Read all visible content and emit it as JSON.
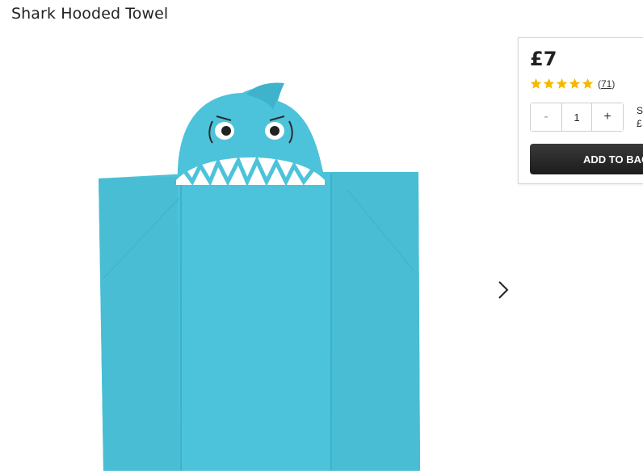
{
  "product": {
    "title": "Shark Hooded Towel",
    "image_alt": "Shark Hooded Towel",
    "price": "£7",
    "rating": {
      "value": 5,
      "max": 5,
      "review_count": "71",
      "star_color": "#f5b800"
    },
    "towel_color": "#4cc3da"
  },
  "purchase": {
    "quantity": "1",
    "minus_label": "-",
    "plus_label": "+",
    "subtotal_label": "Su",
    "subtotal_value": "£",
    "add_to_bag_label": "ADD TO BAG"
  },
  "gallery": {
    "next_icon": "chevron-right-icon"
  }
}
